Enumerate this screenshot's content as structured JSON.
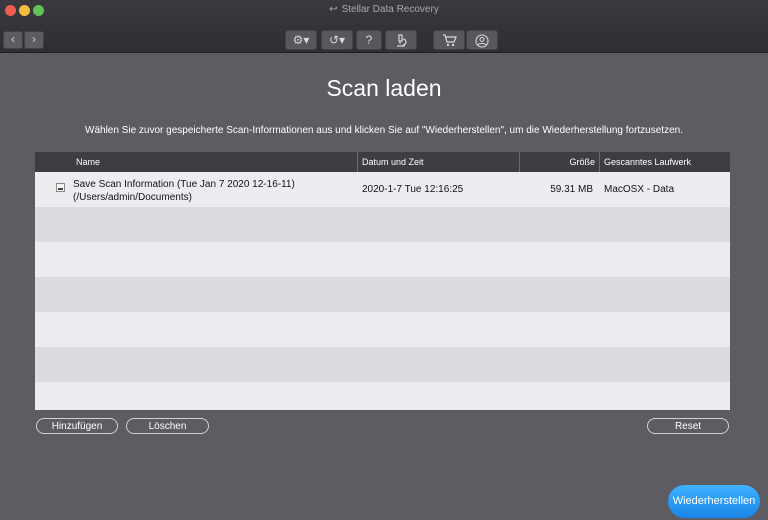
{
  "window": {
    "app_title": "Stellar Data Recovery"
  },
  "toolbar": {
    "settings_icon": "gear-icon",
    "history_icon": "history-icon",
    "help_label": "?",
    "scan_icon": "microscope-icon",
    "cart_icon": "cart-icon",
    "account_icon": "user-icon"
  },
  "page": {
    "title": "Scan laden",
    "description": "Wählen Sie zuvor gespeicherte Scan-Informationen aus und klicken Sie auf \"Wiederherstellen\", um die Wiederherstellung fortzusetzen."
  },
  "table": {
    "columns": [
      "Name",
      "Datum und Zeit",
      "Größe",
      "Gescanntes Laufwerk"
    ],
    "rows": [
      {
        "name_line1": "Save Scan Information (Tue Jan 7 2020 12-16-11)",
        "name_line2": "(/Users/admin/Documents)",
        "datetime": "2020-1-7 Tue 12:16:25",
        "size": "59.31 MB",
        "drive": "MacOSX - Data"
      }
    ]
  },
  "buttons": {
    "add": "Hinzufügen",
    "delete": "Löschen",
    "reset": "Reset",
    "recover": "Wiederherstellen"
  }
}
